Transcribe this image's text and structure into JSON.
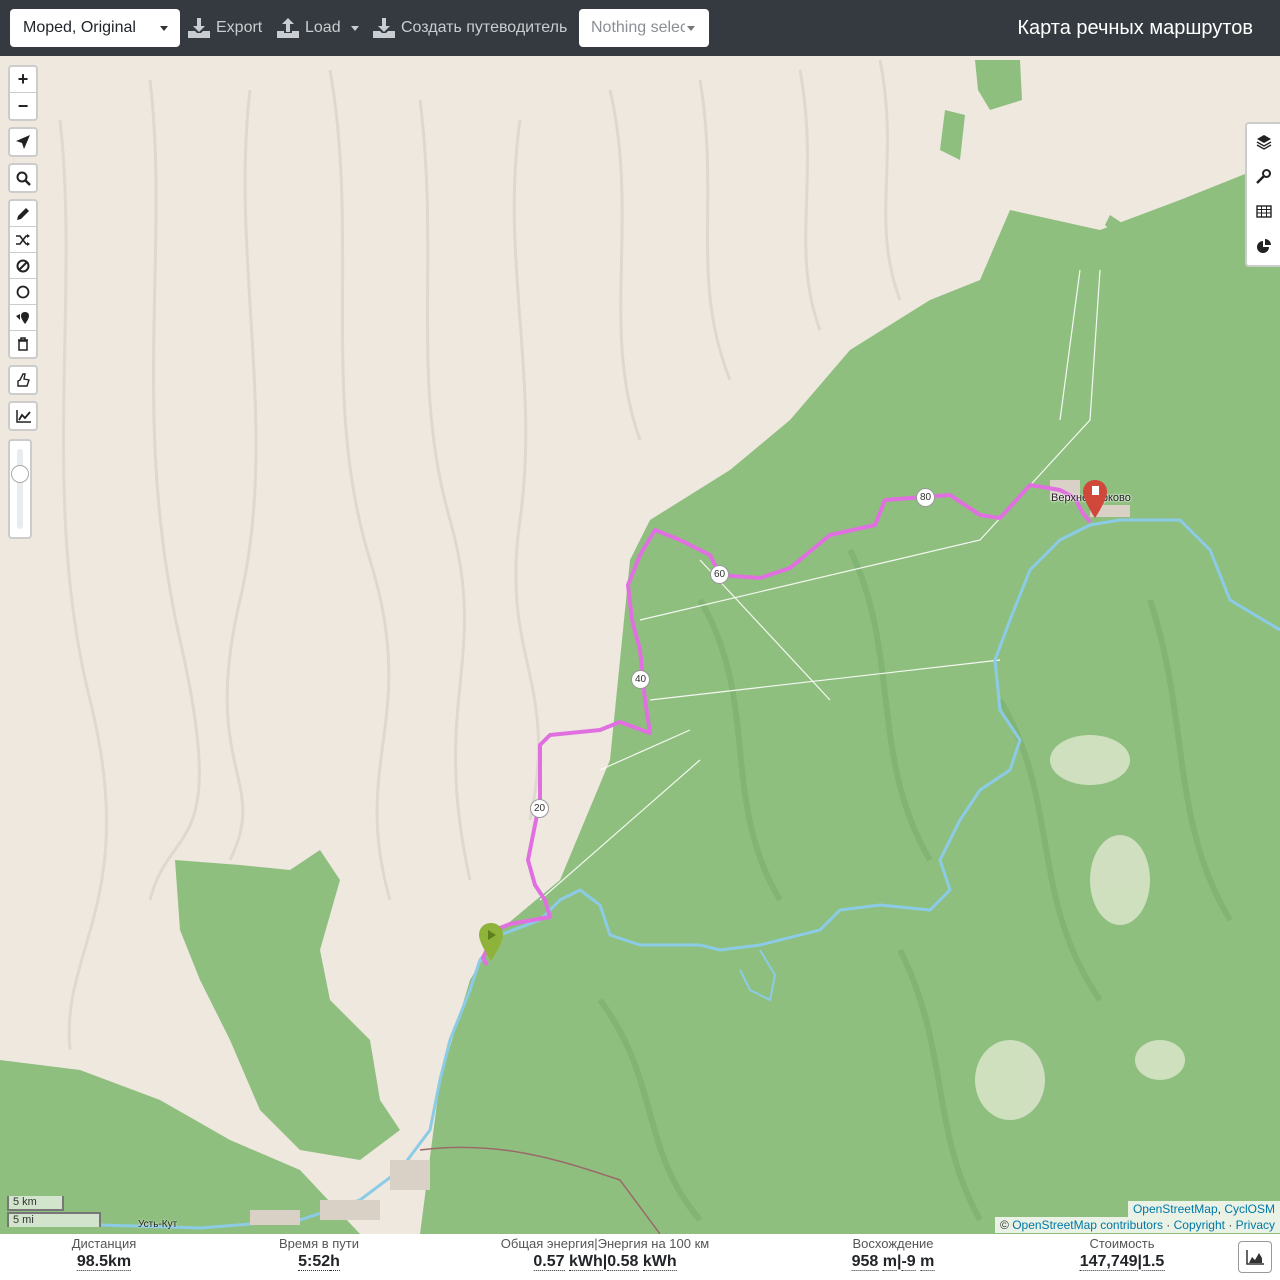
{
  "topbar": {
    "profile": "Moped, Original",
    "export_label": "Export",
    "load_label": "Load",
    "guide_label": "Создать путеводитель",
    "selection_placeholder": "Nothing selected",
    "app_title": "Карта речных маршрутов"
  },
  "map": {
    "place_label": "Верхнемарково",
    "bottom_place_label": "Усть-Кут",
    "route_markers": [
      "20",
      "40",
      "60",
      "80"
    ],
    "route_color": "#e070e0",
    "river_color": "#8ccbe6",
    "forest_color": "#8fbf7f",
    "land_color": "#f0ebe2",
    "scale_km": "5 km",
    "scale_mi": "5 mi",
    "attribution_line1": [
      "OpenStreetMap",
      "CyclOSM"
    ],
    "attribution_line2_prefix": "© ",
    "attribution_line2": [
      "OpenStreetMap contributors",
      "Copyright",
      "Privacy"
    ]
  },
  "stats": {
    "distance": {
      "label": "Дистанция",
      "value": "98.5",
      "unit": "km"
    },
    "time": {
      "label": "Время в пути",
      "value": "5:52",
      "unit": "h"
    },
    "energy": {
      "label": "Общая энергия",
      "label2": "Энергия на 100 км",
      "value": "0.57",
      "unit": "kWh",
      "value2": "0.58",
      "unit2": "kWh"
    },
    "ascent": {
      "label": "Восхождение",
      "value": "958",
      "unit": "m",
      "value2": "-9",
      "unit2": "m"
    },
    "cost": {
      "label": "Стоимость",
      "value": "147,749",
      "value2": "1.5"
    }
  }
}
